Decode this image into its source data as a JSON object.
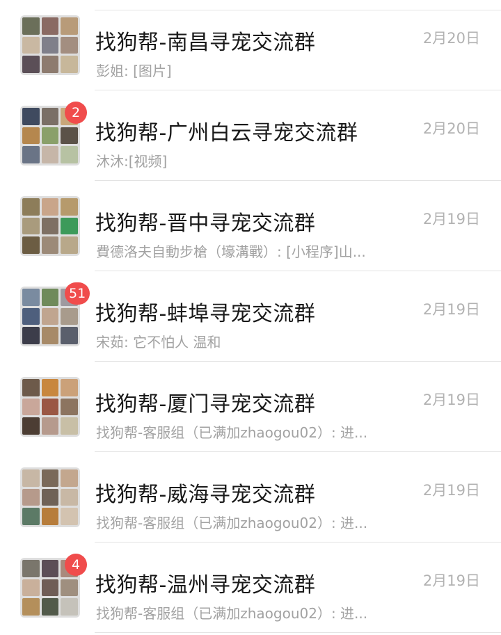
{
  "chats": [
    {
      "title": "找狗帮-南昌寻宠交流群",
      "preview": "彭姐: [图片]",
      "time": "2月20日",
      "badge": null,
      "avatar_colors": [
        "#6b6f5a",
        "#8a6a63",
        "#b89b79",
        "#c9b8a2",
        "#7f7f8a",
        "#a38e80",
        "#5b4f57",
        "#8d7b6f",
        "#c7b79a"
      ]
    },
    {
      "title": "找狗帮-广州白云寻宠交流群",
      "preview": "沐沐:[视频]",
      "time": "2月20日",
      "badge": "2",
      "avatar_colors": [
        "#3f4a5f",
        "#7a6f66",
        "#c9a77a",
        "#b5874e",
        "#8aa06a",
        "#5b5248",
        "#6a7486",
        "#c6b6a8",
        "#b7c2a3"
      ]
    },
    {
      "title": "找狗帮-晋中寻宠交流群",
      "preview": "費德洛夫自動步槍（壕溝戰）: [小程序]山...",
      "time": "2月19日",
      "badge": null,
      "avatar_colors": [
        "#8d7d5a",
        "#c9a58a",
        "#b69a6c",
        "#a99b7d",
        "#7e7064",
        "#3d9a5a",
        "#6c5d43",
        "#9c8a78",
        "#b8a88a"
      ]
    },
    {
      "title": "找狗帮-蚌埠寻宠交流群",
      "preview": "宋茹: 它不怕人 温和",
      "time": "2月19日",
      "badge": "51",
      "avatar_colors": [
        "#7a8ba0",
        "#6f8a5a",
        "#9e9aa0",
        "#4e5f7d",
        "#c0a58f",
        "#a89b8c",
        "#3c3d4a",
        "#a78a68",
        "#5a5f6c"
      ]
    },
    {
      "title": "找狗帮-厦门寻宠交流群",
      "preview": "找狗帮-客服组（已满加zhaogou02）: 进...",
      "time": "2月19日",
      "badge": null,
      "avatar_colors": [
        "#6d5a4a",
        "#c8873e",
        "#cba179",
        "#c9a79a",
        "#9a5744",
        "#8c7460",
        "#4c3d33",
        "#b69a8d",
        "#c8bfa6"
      ]
    },
    {
      "title": "找狗帮-威海寻宠交流群",
      "preview": "找狗帮-客服组（已满加zhaogou02）: 进...",
      "time": "2月19日",
      "badge": null,
      "avatar_colors": [
        "#c7b7a5",
        "#7a6959",
        "#c3a78e",
        "#b69a8b",
        "#6f6257",
        "#c8b8a5",
        "#5c7a66",
        "#b77d3c",
        "#d3c3b0"
      ]
    },
    {
      "title": "找狗帮-温州寻宠交流群",
      "preview": "找狗帮-客服组（已满加zhaogou02）: 进...",
      "time": "2月19日",
      "badge": "4",
      "avatar_colors": [
        "#7a766c",
        "#5c4e57",
        "#a98a7d",
        "#c9b09b",
        "#6f5d56",
        "#9f8f7f",
        "#b48f5b",
        "#525a4a",
        "#c5c2ba"
      ]
    }
  ],
  "colors": {
    "badge": "#f04c4c",
    "title": "#191919",
    "preview": "#a2a2a2",
    "time": "#b2b2b2",
    "divider": "#e3e3e3"
  }
}
